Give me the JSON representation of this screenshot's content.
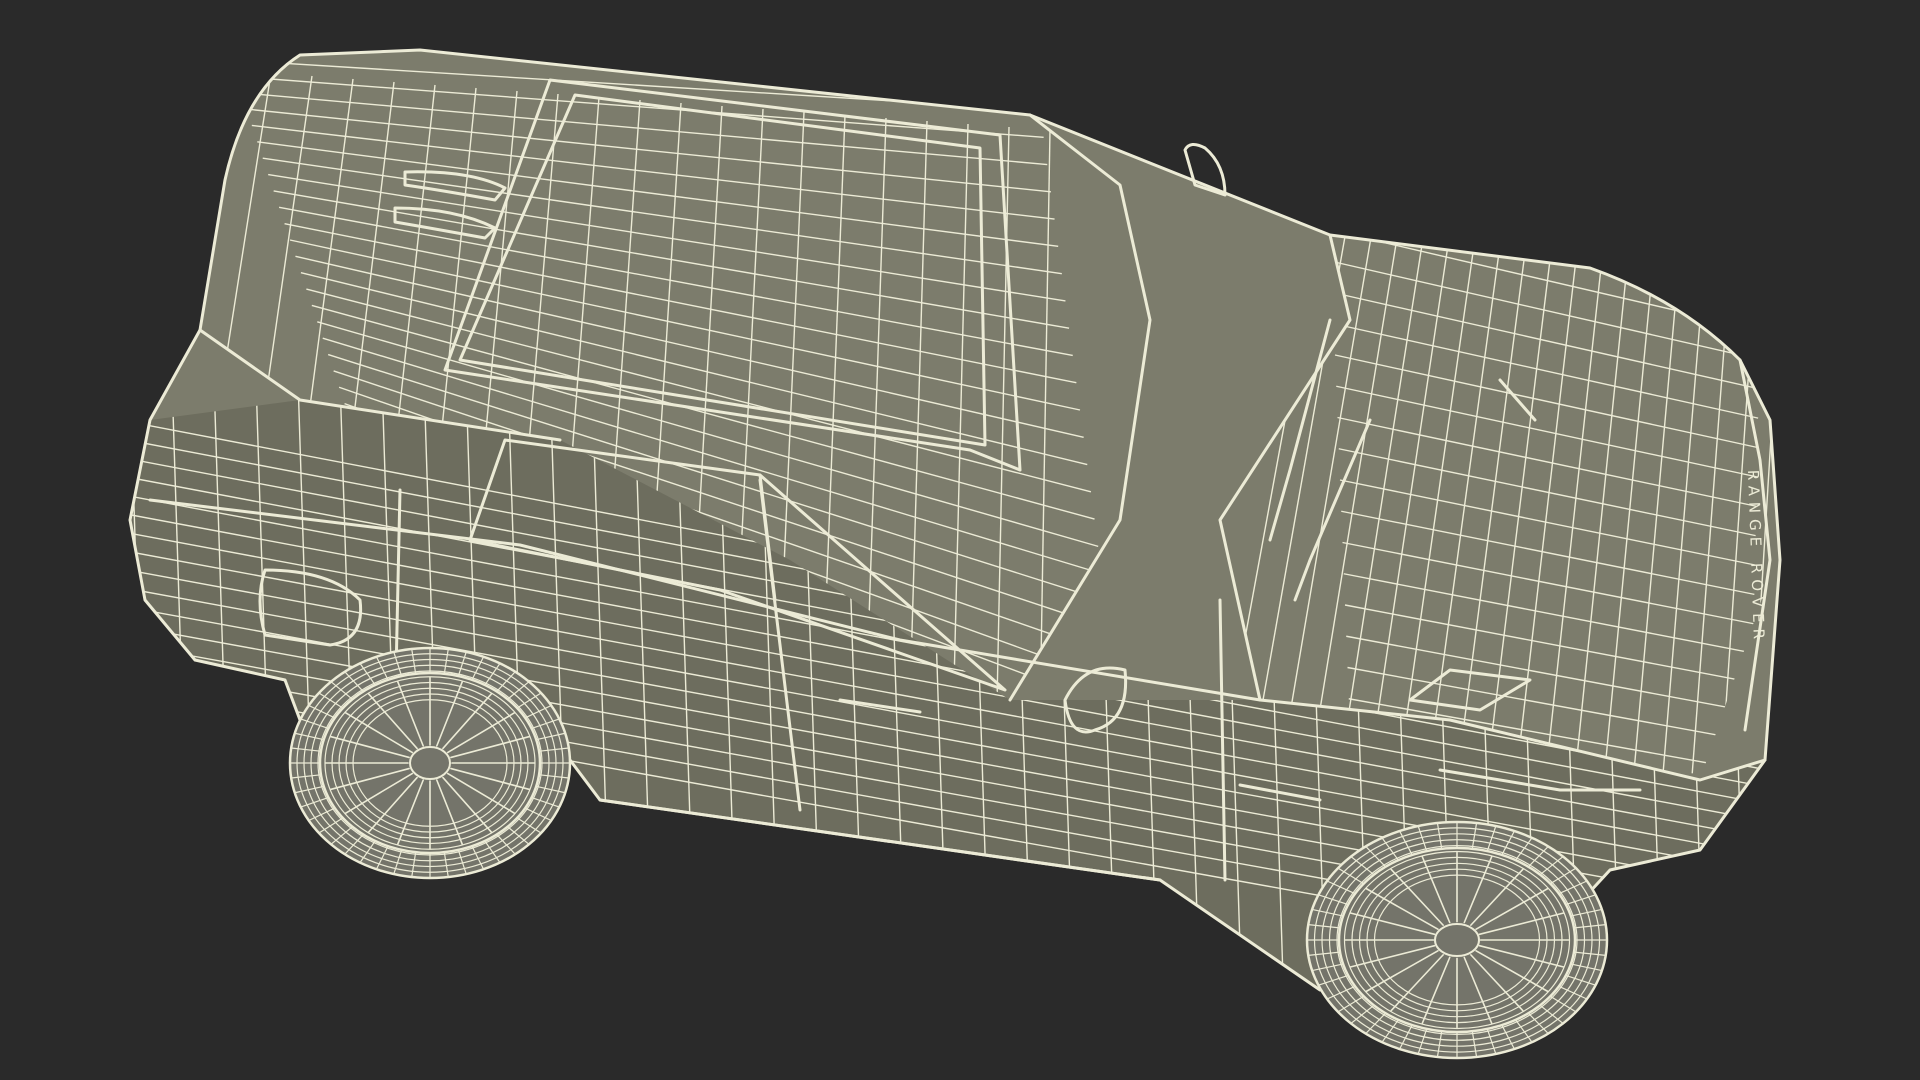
{
  "scene": {
    "background_color": "#2a2a2a",
    "body_color": "#7c7c6c",
    "body_shade_color": "#6d6d5e",
    "wire_color": "#ecebd6",
    "tire_color": "#74746a",
    "subject": "wireframe-suv-render"
  },
  "car": {
    "badge_text": "RANGE ROVER"
  }
}
